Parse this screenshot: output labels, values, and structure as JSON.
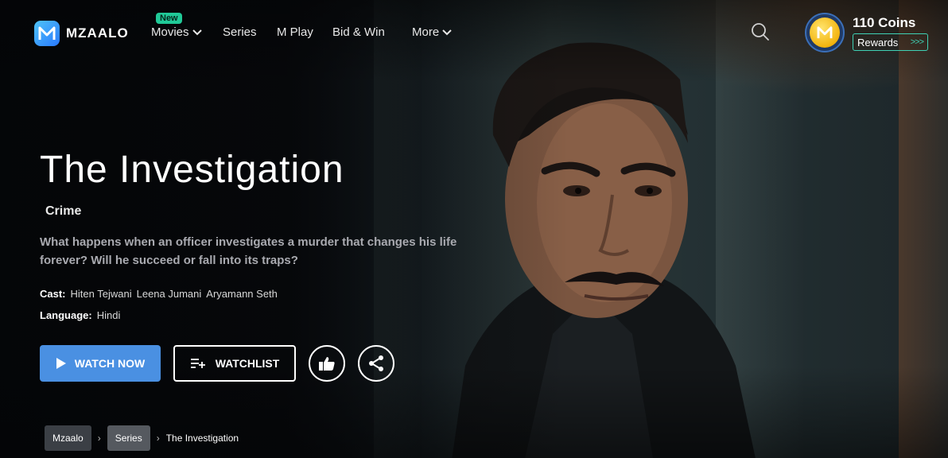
{
  "header": {
    "logo_text": "MZAALO",
    "nav": [
      {
        "label": "Movies",
        "has_dropdown": true
      },
      {
        "label": "Series",
        "has_dropdown": false
      },
      {
        "label": "M Play",
        "has_dropdown": false,
        "badge": "New"
      },
      {
        "label": "Bid & Win",
        "has_dropdown": false
      },
      {
        "label": "More",
        "has_dropdown": true
      }
    ],
    "search_icon": "search-icon",
    "coins_label": "110 Coins",
    "rewards_label": "Rewards",
    "rewards_arrows": ">>>"
  },
  "hero": {
    "title": "The Investigation",
    "genre": "Crime",
    "description": "What happens when an officer investigates a murder that changes his life forever? Will he succeed or fall into its traps?",
    "cast_label": "Cast:",
    "cast": [
      "Hiten Tejwani",
      "Leena Jumani",
      "Aryamann Seth"
    ],
    "language_label": "Language:",
    "language": "Hindi",
    "watch_now_label": "WATCH NOW",
    "watchlist_label": "WATCHLIST"
  },
  "breadcrumb": {
    "home": "Mzaalo",
    "section": "Series",
    "current": "The Investigation"
  },
  "colors": {
    "accent_blue": "#4a90e2",
    "new_badge": "#20c997",
    "rewards_border": "#3fd1b5",
    "coin_gold": "#f3b40f"
  }
}
